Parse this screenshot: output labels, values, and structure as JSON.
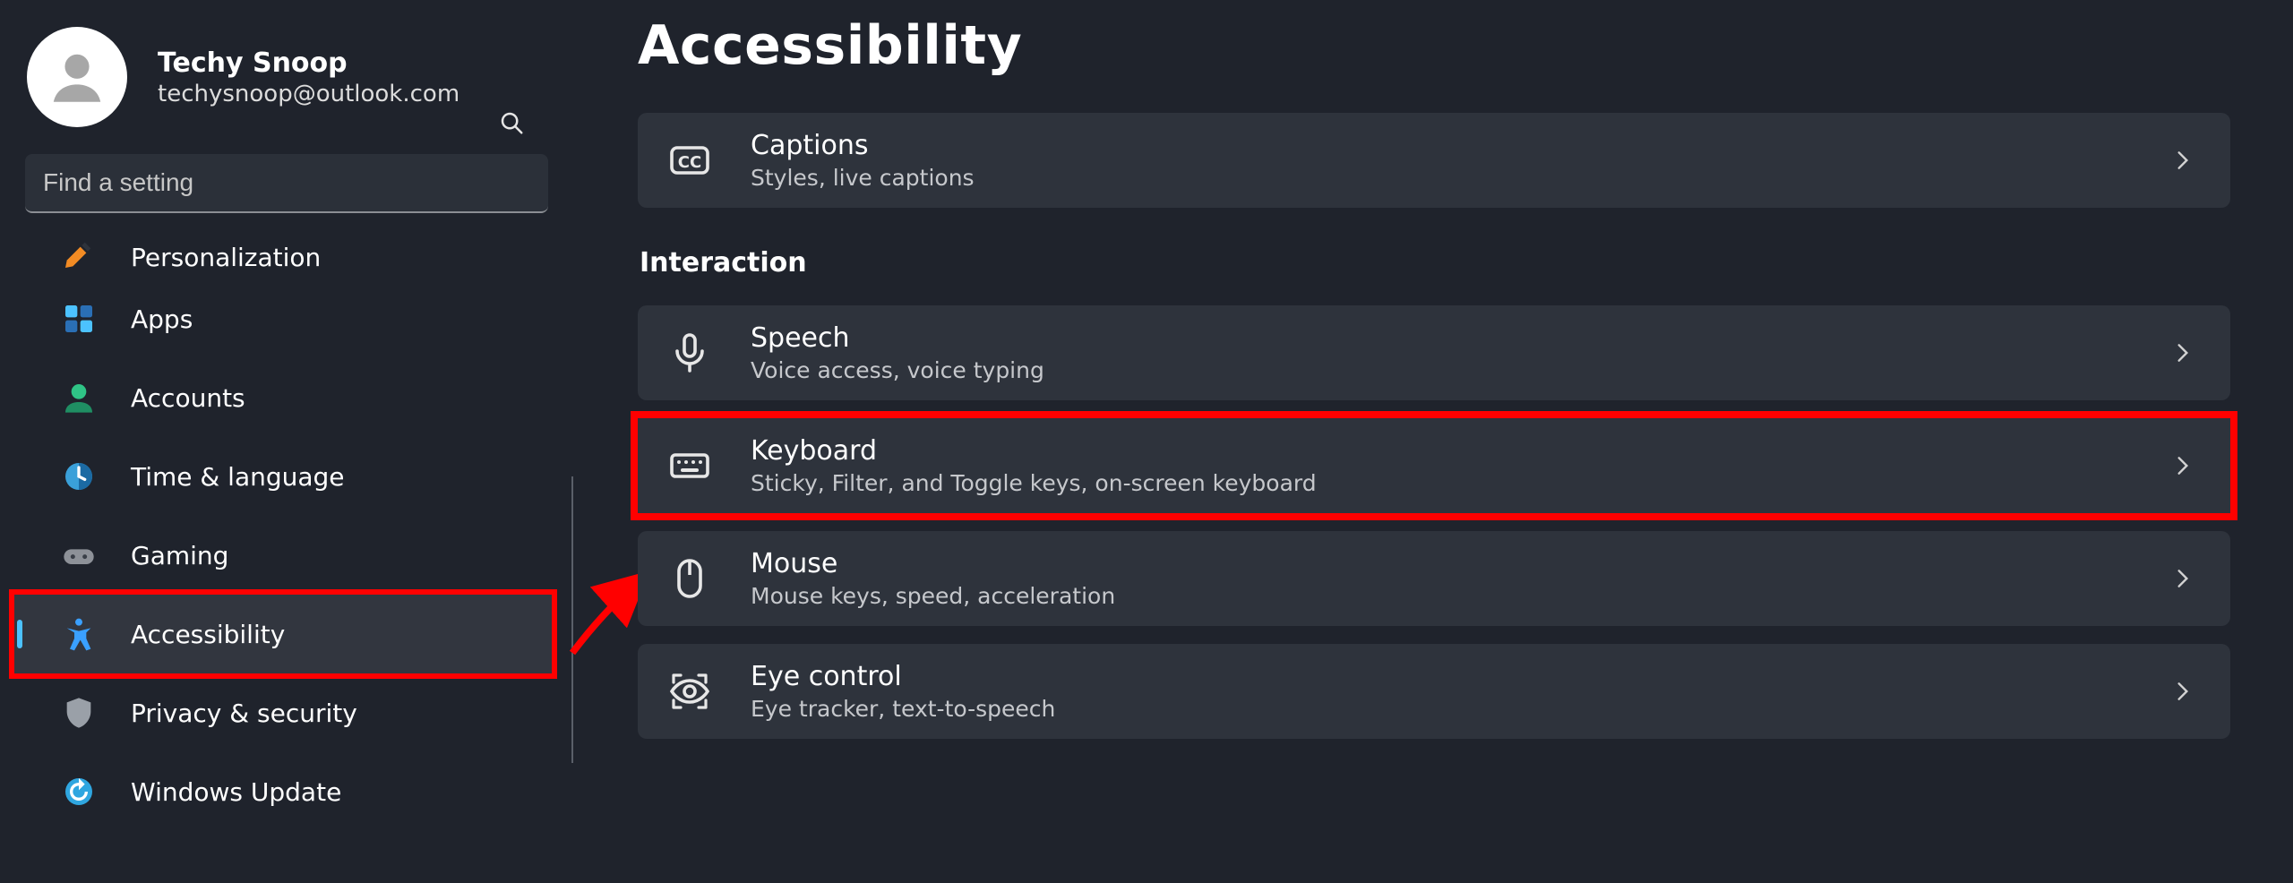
{
  "profile": {
    "name": "Techy Snoop",
    "email": "techysnoop@outlook.com"
  },
  "search": {
    "placeholder": "Find a setting"
  },
  "sidebar": {
    "items": [
      {
        "label": "Personalization"
      },
      {
        "label": "Apps"
      },
      {
        "label": "Accounts"
      },
      {
        "label": "Time & language"
      },
      {
        "label": "Gaming"
      },
      {
        "label": "Accessibility"
      },
      {
        "label": "Privacy & security"
      },
      {
        "label": "Windows Update"
      }
    ]
  },
  "page": {
    "title": "Accessibility",
    "section_interaction": "Interaction"
  },
  "tiles": {
    "captions": {
      "title": "Captions",
      "desc": "Styles, live captions"
    },
    "speech": {
      "title": "Speech",
      "desc": "Voice access, voice typing"
    },
    "keyboard": {
      "title": "Keyboard",
      "desc": "Sticky, Filter, and Toggle keys, on-screen keyboard"
    },
    "mouse": {
      "title": "Mouse",
      "desc": "Mouse keys, speed, acceleration"
    },
    "eye": {
      "title": "Eye control",
      "desc": "Eye tracker, text-to-speech"
    }
  }
}
